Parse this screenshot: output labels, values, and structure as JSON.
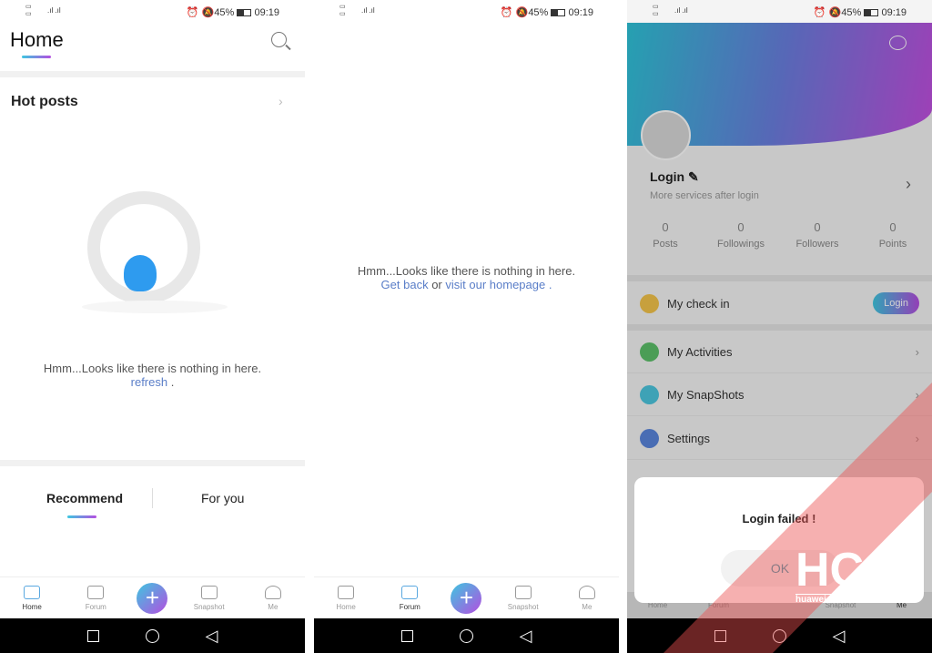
{
  "status": {
    "battery": "45%",
    "time": "09:19",
    "signal": "4G"
  },
  "screen1": {
    "title": "Home",
    "section": "Hot posts",
    "empty_msg": "Hmm...Looks like there is nothing in here.",
    "refresh": "refresh",
    "refresh_suffix": " .",
    "tabs": [
      "Recommend",
      "For you"
    ]
  },
  "screen2": {
    "empty_msg": "Hmm...Looks like there is nothing in here.",
    "get_back": "Get back",
    "or": " or ",
    "visit": "visit our homepage",
    "suffix": " ."
  },
  "nav": {
    "home": "Home",
    "forum": "Forum",
    "snapshot": "Snapshot",
    "me": "Me",
    "plus": "+"
  },
  "screen3": {
    "login": "Login",
    "subtitle": "More services after login",
    "stats": [
      {
        "value": "0",
        "label": "Posts"
      },
      {
        "value": "0",
        "label": "Followings"
      },
      {
        "value": "0",
        "label": "Followers"
      },
      {
        "value": "0",
        "label": "Points"
      }
    ],
    "checkin": "My check in",
    "checkin_button": "Login",
    "items": [
      "My Activities",
      "My SnapShots",
      "Settings"
    ],
    "dialog": {
      "message": "Login failed !",
      "ok": "OK"
    }
  },
  "watermark": {
    "logo": "HC",
    "site": "huaweicentral.com"
  },
  "colors": {
    "accent_start": "#3ec7e0",
    "accent_end": "#b44ee0",
    "link": "#5a7ec8"
  }
}
